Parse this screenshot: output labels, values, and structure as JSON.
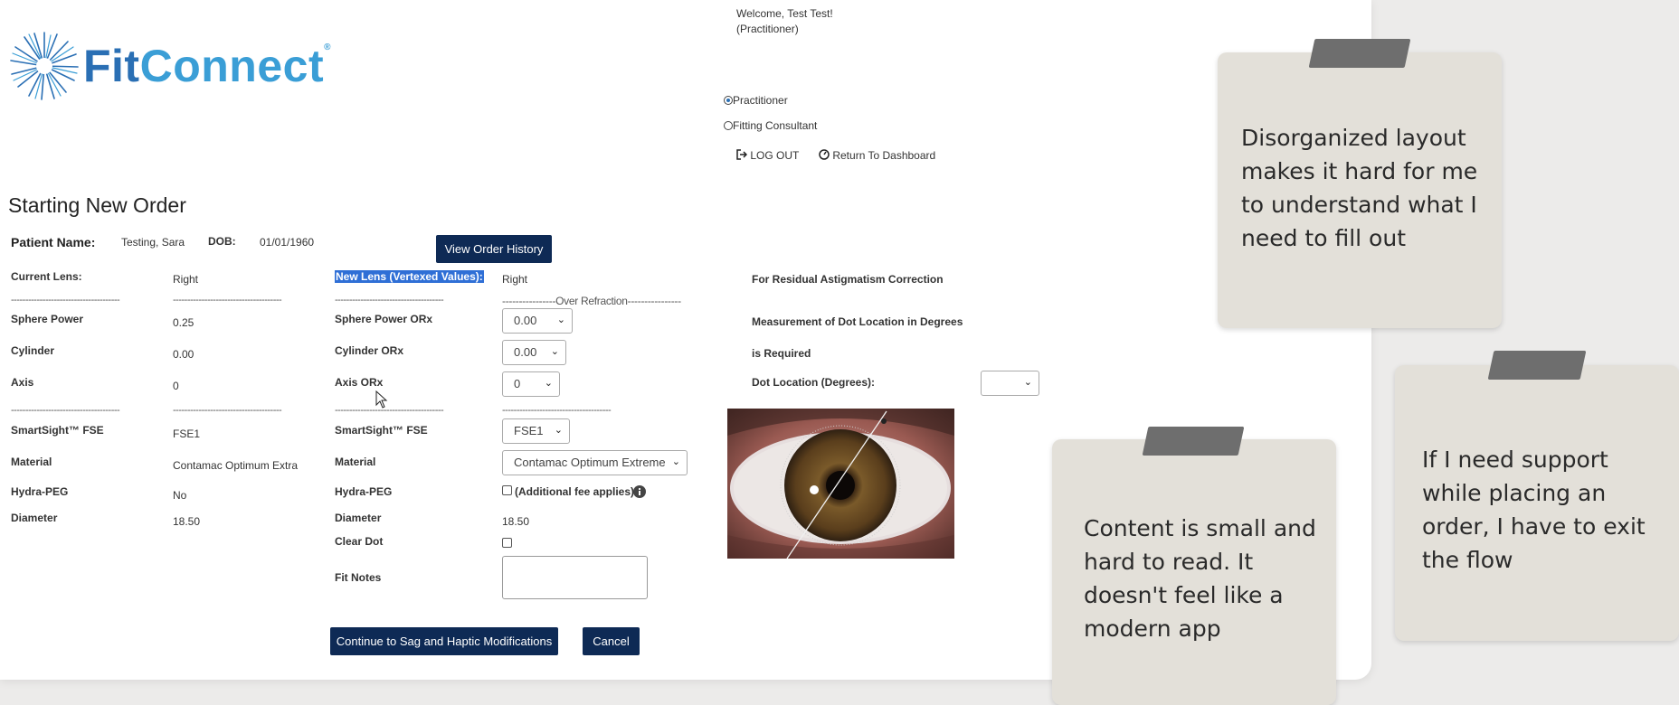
{
  "header": {
    "logo_main": "FitConnect",
    "logo_part1": "Fit",
    "logo_part2": "Connect",
    "logo_reg": "®",
    "welcome": "Welcome, Test Test!",
    "role_line": "(Practitioner)",
    "role_options": [
      {
        "label": "Practitioner",
        "selected": true
      },
      {
        "label": "Fitting Consultant",
        "selected": false
      }
    ],
    "logout_label": "LOG OUT",
    "dashboard_label": "Return To Dashboard"
  },
  "page": {
    "title": "Starting New Order",
    "patient_label": "Patient Name:",
    "patient_name": "Testing, Sara",
    "dob_label": "DOB:",
    "dob_value": "01/01/1960",
    "history_button": "View Order History"
  },
  "current_lens": {
    "heading": "Current Lens:",
    "eye": "Right",
    "dashes": "--------------------------------------",
    "rows": [
      {
        "label": "Sphere Power",
        "value": "0.25"
      },
      {
        "label": "Cylinder",
        "value": "0.00"
      },
      {
        "label": "Axis",
        "value": "0"
      }
    ],
    "rows2": [
      {
        "label": "SmartSight™ FSE",
        "value": "FSE1"
      },
      {
        "label": "Material",
        "value": "Contamac Optimum Extra"
      },
      {
        "label": "Hydra-PEG",
        "value": "No"
      },
      {
        "label": "Diameter",
        "value": "18.50"
      }
    ]
  },
  "new_lens": {
    "heading": "New Lens (Vertexed Values):",
    "eye": "Right",
    "over_refraction": "----------------Over Refraction----------------",
    "rows": [
      {
        "label": "Sphere Power ORx",
        "value": "0.00"
      },
      {
        "label": "Cylinder ORx",
        "value": "0.00"
      },
      {
        "label": "Axis ORx",
        "value": "0"
      }
    ],
    "fse_label": "SmartSight™ FSE",
    "fse_value": "FSE1",
    "material_label": "Material",
    "material_value": "Contamac Optimum Extreme",
    "hydra_label": "Hydra-PEG",
    "hydra_note": "(Additional fee applies)",
    "diameter_label": "Diameter",
    "diameter_value": "18.50",
    "clear_dot_label": "Clear Dot",
    "fit_notes_label": "Fit Notes",
    "fit_notes_value": ""
  },
  "residual": {
    "heading": "For Residual Astigmatism Correction",
    "line1": "Measurement of Dot Location in Degrees",
    "line2": "is Required",
    "dot_label": "Dot Location (Degrees):",
    "dot_value": ""
  },
  "actions": {
    "continue_label": "Continue to Sag and Haptic Modifications",
    "cancel_label": "Cancel"
  },
  "sticky_notes": [
    {
      "text": "Disorganized layout makes it hard for me to understand what I need to fill out"
    },
    {
      "text": "Content is small and hard to read. It doesn't feel like a modern app"
    },
    {
      "text": "If I need support while placing an order, I have to exit the flow"
    }
  ],
  "colors": {
    "brand_dark": "#0e2a55",
    "logo_blue": "#2a6fb4",
    "logo_light_blue": "#3a9ed6",
    "note_bg": "#e3e0d9",
    "highlight": "#2f6fd6"
  }
}
